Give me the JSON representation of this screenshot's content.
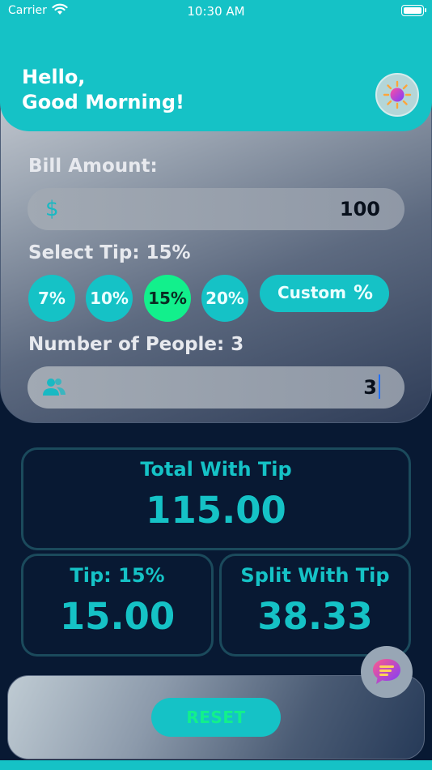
{
  "status_bar": {
    "carrier": "Carrier",
    "time": "10:30 AM"
  },
  "header": {
    "greeting_line1": "Hello,",
    "greeting_line2": "Good Morning!",
    "theme_icon": "sun-icon"
  },
  "bill": {
    "label": "Bill Amount:",
    "currency_symbol": "$",
    "value": "100"
  },
  "tip": {
    "label": "Select Tip: 15%",
    "options": [
      "7%",
      "10%",
      "15%",
      "20%"
    ],
    "selected": "15%",
    "custom_label": "Custom",
    "custom_symbol": "%"
  },
  "people": {
    "label": "Number of People: 3",
    "value": "3",
    "icon": "people-icon"
  },
  "results": {
    "total_label": "Total With Tip",
    "total_value": "115.00",
    "tip_label": "Tip: 15%",
    "tip_value": "15.00",
    "split_label": "Split With Tip",
    "split_value": "38.33"
  },
  "reset_label": "RESET",
  "chat_icon": "chat-icon",
  "colors": {
    "accent": "#15c2c6",
    "selected": "#12f08c",
    "background": "#081933"
  }
}
